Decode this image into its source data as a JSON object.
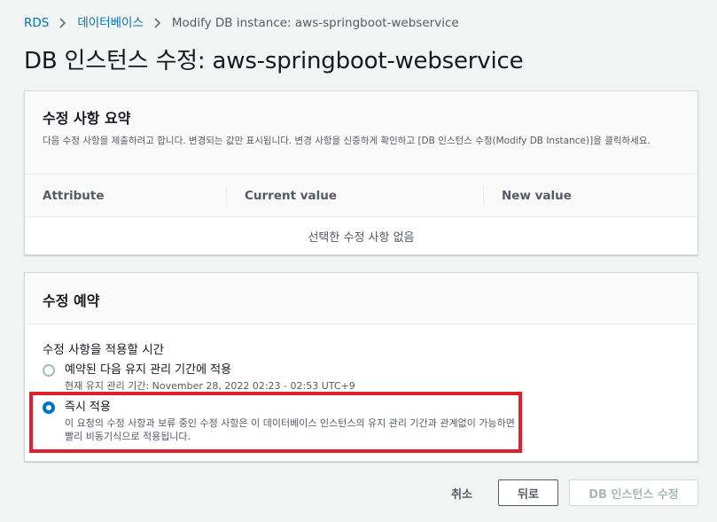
{
  "breadcrumb": {
    "items": [
      "RDS",
      "데이터베이스"
    ],
    "current": "Modify DB instance: aws-springboot-webservice"
  },
  "page": {
    "title": "DB 인스턴스 수정: aws-springboot-webservice"
  },
  "summary": {
    "title": "수정 사항 요약",
    "description": "다음 수정 사항을 제출하려고 합니다. 변경되는 값만 표시됩니다. 변경 사항을 신중하게 확인하고 [DB 인스턴스 수정(Modify DB Instance)]을 클릭하세요.",
    "columns": [
      "Attribute",
      "Current value",
      "New value"
    ],
    "empty_text": "선택한 수정 사항 없음"
  },
  "schedule": {
    "title": "수정 예약",
    "field_label": "수정 사항을 적용할 시간",
    "options": [
      {
        "label": "예약된 다음 유지 관리 기간에 적용",
        "description": "현재 유지 관리 기간: November 28, 2022 02:23 - 02:53 UTC+9",
        "checked": false
      },
      {
        "label": "즉시 적용",
        "description": "이 요청의 수정 사항과 보류 중인 수정 사항은 이 데이터베이스 인스턴스의 유지 관리 기간과 관계없이 가능하면 빨리 비동기식으로 적용됩니다.",
        "checked": true
      }
    ]
  },
  "actions": {
    "cancel": "취소",
    "back": "뒤로",
    "submit": "DB 인스턴스 수정"
  },
  "colors": {
    "accent": "#0073bb",
    "highlight": "#e0202a",
    "background": "#f2f3f3"
  }
}
